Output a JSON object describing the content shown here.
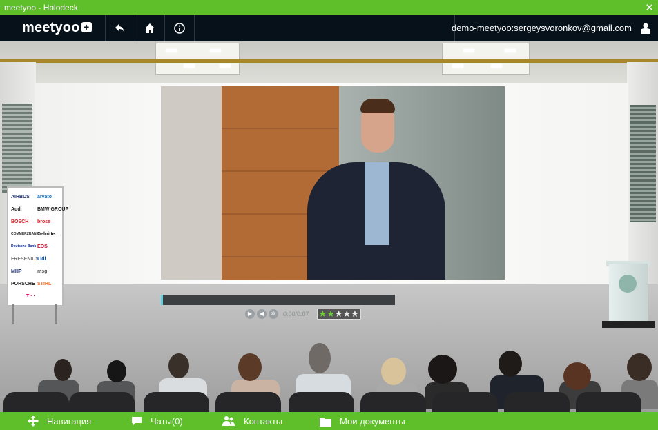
{
  "window": {
    "title": "meetyoo - Holodeck",
    "close_glyph": "✕"
  },
  "navbar": {
    "logo_text": "meetyoo",
    "logo_plus": "+",
    "back_icon": "back-arrow-icon",
    "home_icon": "home-icon",
    "info_icon": "info-icon",
    "user_email": "demo-meetyoo:sergeysvoronkov@gmail.com",
    "user_icon": "user-icon"
  },
  "video": {
    "progress": 0.005,
    "controls": [
      "play-icon",
      "volume-icon",
      "settings-icon"
    ],
    "time": "0:00/0:07",
    "rating": {
      "filled": 2,
      "total": 5
    }
  },
  "sponsor_board": {
    "logos": [
      "AIRBUS",
      "arvato",
      "Audi",
      "BMW GROUP",
      "BOSCH",
      "brose",
      "COMMERZBANK",
      "Deloitte.",
      "Deutsche Bank",
      "EOS",
      "FRESENIUS",
      "Lidl",
      "MHP",
      "msg",
      "PORSCHE",
      "STIHL",
      "T · ·"
    ]
  },
  "bottom_bar": {
    "items": [
      {
        "label": "Навигация",
        "icon": "move-arrows-icon"
      },
      {
        "label": "Чаты(0)",
        "icon": "chat-bubble-icon"
      },
      {
        "label": "Контакты",
        "icon": "contacts-icon"
      },
      {
        "label": "Мои документы",
        "icon": "folder-icon"
      }
    ]
  },
  "colors": {
    "accent": "#5fbf2a",
    "navbar": "#06111a"
  }
}
